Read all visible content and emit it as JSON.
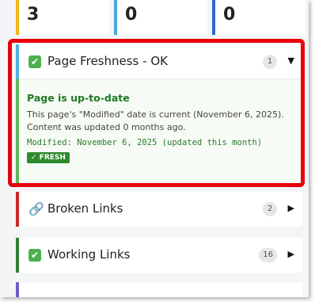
{
  "stats": [
    {
      "value": "3",
      "color": "#f2b21b"
    },
    {
      "value": "0",
      "color": "#4aa8e0"
    },
    {
      "value": "0",
      "color": "#2e6bcc"
    }
  ],
  "freshness": {
    "icon": "check-icon",
    "title": "Page Freshness - OK",
    "count": "1",
    "toggle": "▼",
    "body_title": "Page is up-to-date",
    "body_desc": "This page's \"Modified\" date is current (November 6, 2025). Content was updated 0 months ago.",
    "modified_line": "Modified: November 6, 2025 (updated this month)",
    "badge": "✓ FRESH"
  },
  "broken_links": {
    "icon": "link-icon",
    "title": "Broken Links",
    "count": "2",
    "toggle": "▶"
  },
  "working_links": {
    "icon": "check-icon",
    "title": "Working Links",
    "count": "16",
    "toggle": "▶"
  },
  "colors": {
    "highlight": "#e8000b",
    "ok_green": "#2f8a2f",
    "broken_red": "#c62828"
  }
}
